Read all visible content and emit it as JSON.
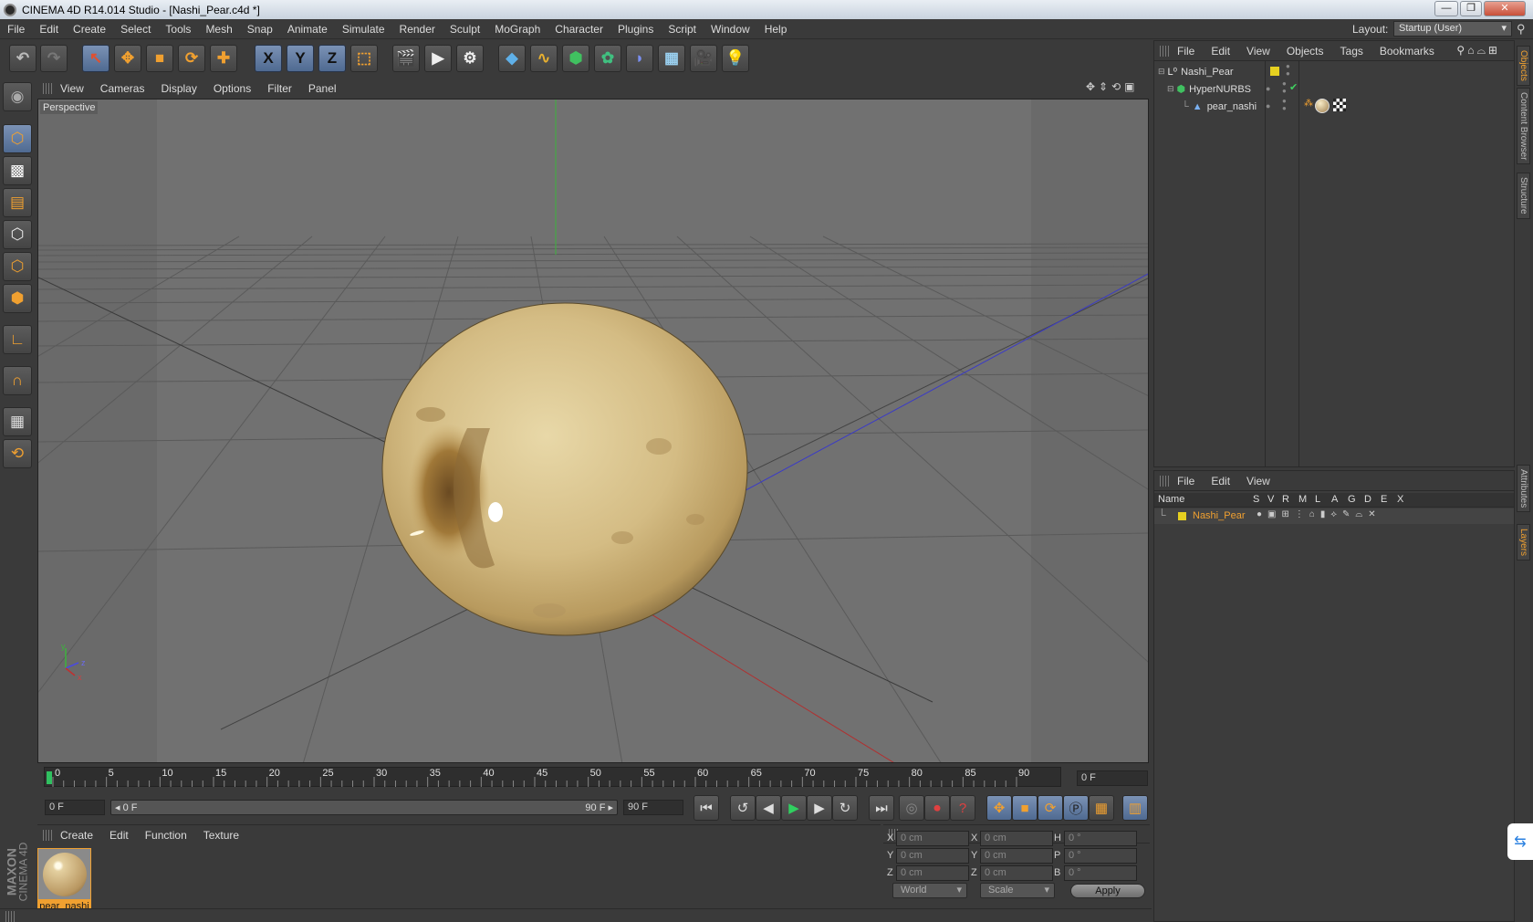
{
  "window": {
    "title": "CINEMA 4D R14.014 Studio - [Nashi_Pear.c4d *]"
  },
  "menu": [
    "File",
    "Edit",
    "Create",
    "Select",
    "Tools",
    "Mesh",
    "Snap",
    "Animate",
    "Simulate",
    "Render",
    "Sculpt",
    "MoGraph",
    "Character",
    "Plugins",
    "Script",
    "Window",
    "Help"
  ],
  "layout": {
    "label": "Layout:",
    "value": "Startup (User)"
  },
  "toolbar_axes": {
    "x": "X",
    "y": "Y",
    "z": "Z"
  },
  "viewport": {
    "menu": [
      "View",
      "Cameras",
      "Display",
      "Options",
      "Filter",
      "Panel"
    ],
    "label": "Perspective",
    "axis": {
      "x": "x",
      "y": "y",
      "z": "z"
    }
  },
  "timeline": {
    "ticks": [
      "0",
      "5",
      "10",
      "15",
      "20",
      "25",
      "30",
      "35",
      "40",
      "45",
      "50",
      "55",
      "60",
      "65",
      "70",
      "75",
      "80",
      "85",
      "90"
    ],
    "current_frame": "0 F",
    "start_field": "0 F",
    "slider_start": "0 F",
    "slider_end": "90 F",
    "end_field": "90 F"
  },
  "materials": {
    "menu": [
      "Create",
      "Edit",
      "Function",
      "Texture"
    ],
    "items": [
      {
        "name": "pear_nashi"
      }
    ],
    "brand_top": "MAXON",
    "brand_bottom": "CINEMA 4D"
  },
  "coords": {
    "headers": [
      "--",
      "--",
      "--"
    ],
    "rows": [
      {
        "l1": "X",
        "v1": "0 cm",
        "l2": "X",
        "v2": "0 cm",
        "l3": "H",
        "v3": "0 °"
      },
      {
        "l1": "Y",
        "v1": "0 cm",
        "l2": "Y",
        "v2": "0 cm",
        "l3": "P",
        "v3": "0 °"
      },
      {
        "l1": "Z",
        "v1": "0 cm",
        "l2": "Z",
        "v2": "0 cm",
        "l3": "B",
        "v3": "0 °"
      }
    ],
    "space": "World",
    "mode": "Scale",
    "apply": "Apply"
  },
  "objects": {
    "menu": [
      "File",
      "Edit",
      "View",
      "Objects",
      "Tags",
      "Bookmarks"
    ],
    "tree": [
      {
        "name": "Nashi_Pear",
        "indent": 0
      },
      {
        "name": "HyperNURBS",
        "indent": 1
      },
      {
        "name": "pear_nashi",
        "indent": 2
      }
    ]
  },
  "layers": {
    "menu": [
      "File",
      "Edit",
      "View"
    ],
    "columns": [
      "Name",
      "S",
      "V",
      "R",
      "M",
      "L",
      "A",
      "G",
      "D",
      "E",
      "X"
    ],
    "rows": [
      {
        "name": "Nashi_Pear"
      }
    ]
  },
  "side_tabs": [
    "Objects",
    "Content Browser",
    "Structure",
    "Attributes",
    "Layers"
  ],
  "colors": {
    "accent": "#f0a030",
    "selected": "#5a76a0",
    "layer": "#e6d020"
  }
}
